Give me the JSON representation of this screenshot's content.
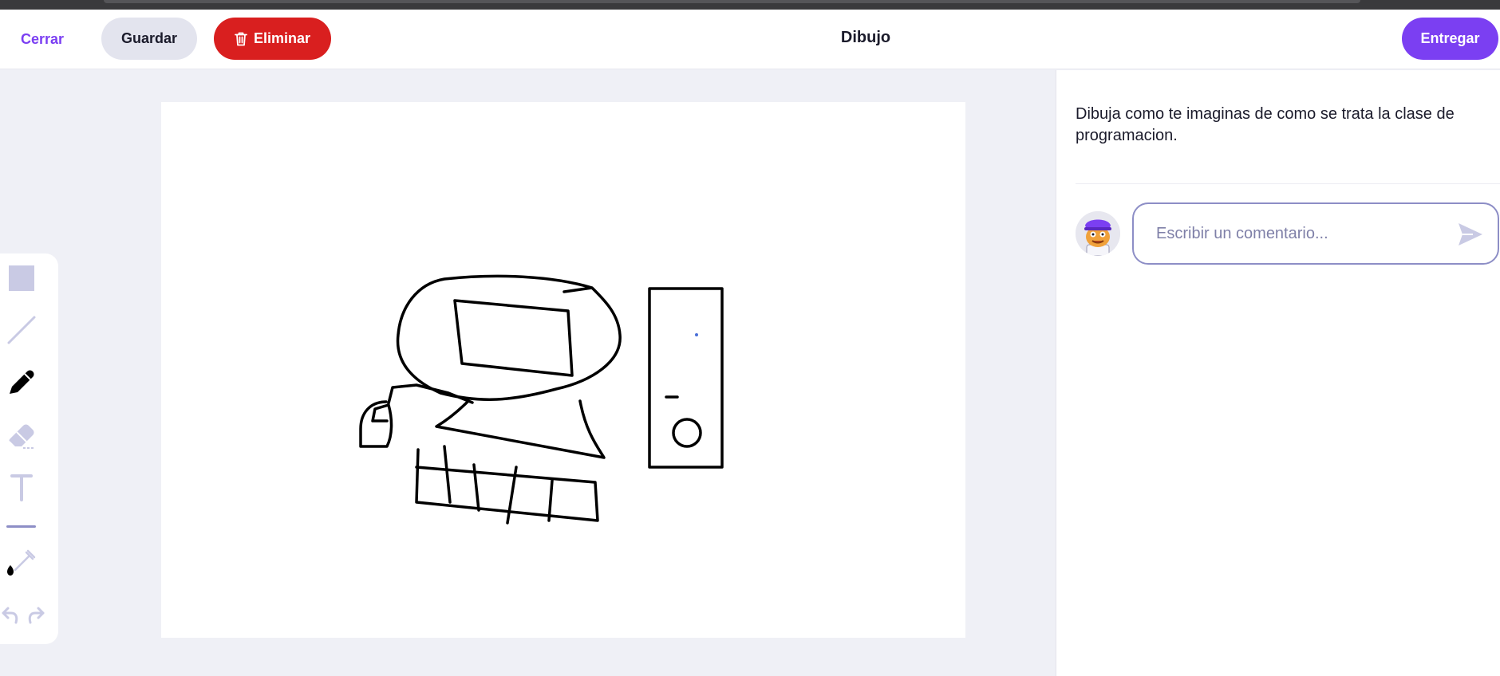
{
  "header": {
    "close_label": "Cerrar",
    "save_label": "Guardar",
    "delete_label": "Eliminar",
    "title": "Dibujo",
    "submit_label": "Entregar"
  },
  "toolbar": {
    "tools": [
      "rectangle-icon",
      "line-icon",
      "pencil-icon",
      "eraser-icon",
      "text-icon",
      "eyedropper-icon",
      "undo-icon",
      "redo-icon"
    ],
    "selected_tool": "pencil-icon",
    "current_color": "#000000"
  },
  "task": {
    "prompt": "Dibuja como te imaginas de como se trata la clase de programacion."
  },
  "comment": {
    "placeholder": "Escribir un comentario..."
  },
  "colors": {
    "accent": "#7b3ff2",
    "danger": "#d91f1f",
    "tool_inactive": "#c9cae4",
    "background": "#eff0f6"
  }
}
